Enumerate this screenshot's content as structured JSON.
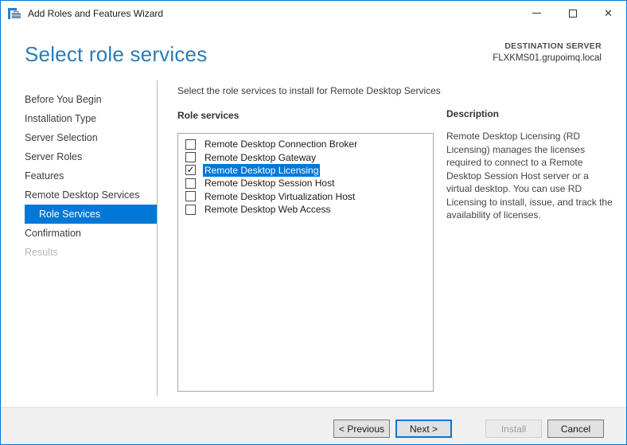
{
  "window": {
    "title": "Add Roles and Features Wizard",
    "app_icon": "server-manager-icon",
    "controls": {
      "minimize": "minimize",
      "maximize": "maximize",
      "close": "close",
      "close_glyph": "✕"
    }
  },
  "header": {
    "title": "Select role services",
    "destination_label": "DESTINATION SERVER",
    "destination_server": "FLXKMS01.grupoimq.local"
  },
  "sidebar": {
    "items": [
      {
        "label": "Before You Begin",
        "state": "normal"
      },
      {
        "label": "Installation Type",
        "state": "normal"
      },
      {
        "label": "Server Selection",
        "state": "normal"
      },
      {
        "label": "Server Roles",
        "state": "normal"
      },
      {
        "label": "Features",
        "state": "normal"
      },
      {
        "label": "Remote Desktop Services",
        "state": "normal"
      },
      {
        "label": "Role Services",
        "state": "selected"
      },
      {
        "label": "Confirmation",
        "state": "normal"
      },
      {
        "label": "Results",
        "state": "disabled"
      }
    ]
  },
  "main": {
    "instruction": "Select the role services to install for Remote Desktop Services",
    "list_label": "Role services",
    "check_glyph": "✓",
    "role_services": [
      {
        "label": "Remote Desktop Connection Broker",
        "checked": false,
        "selected": false
      },
      {
        "label": "Remote Desktop Gateway",
        "checked": false,
        "selected": false
      },
      {
        "label": "Remote Desktop Licensing",
        "checked": true,
        "selected": true
      },
      {
        "label": "Remote Desktop Session Host",
        "checked": false,
        "selected": false
      },
      {
        "label": "Remote Desktop Virtualization Host",
        "checked": false,
        "selected": false
      },
      {
        "label": "Remote Desktop Web Access",
        "checked": false,
        "selected": false
      }
    ]
  },
  "description_panel": {
    "title": "Description",
    "text": "Remote Desktop Licensing (RD Licensing) manages the licenses required to connect to a Remote Desktop Session Host server or a virtual desktop. You can use RD Licensing to install, issue, and track the availability of licenses."
  },
  "footer": {
    "buttons": [
      {
        "label": "< Previous",
        "state": "normal"
      },
      {
        "label": "Next >",
        "state": "default"
      },
      {
        "label": "Install",
        "state": "disabled"
      },
      {
        "label": "Cancel",
        "state": "normal"
      }
    ]
  },
  "colors": {
    "accent": "#0078d7",
    "heading_blue": "#2b7cb5",
    "selection_blue": "#0078d7",
    "footer_bg": "#f0f0f0",
    "disabled_text": "#9b9b9b",
    "sidebar_disabled_text": "#b8b8b8"
  }
}
